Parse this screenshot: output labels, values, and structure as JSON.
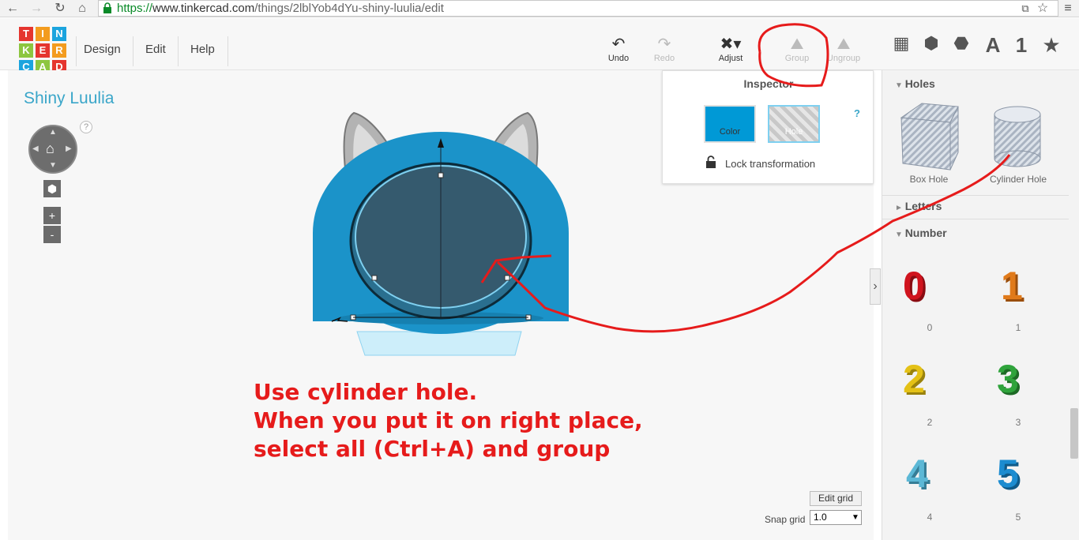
{
  "browser": {
    "url_scheme": "https://",
    "url_host": "www.tinkercad.com",
    "url_path": "/things/2lblYob4dYu-shiny-luulia/edit"
  },
  "logo": {
    "letters": [
      "T",
      "I",
      "N",
      "K",
      "E",
      "R",
      "C",
      "A",
      "D"
    ]
  },
  "menu": {
    "items": [
      "Design",
      "Edit",
      "Help"
    ]
  },
  "toolbar": {
    "undo": "Undo",
    "redo": "Redo",
    "adjust": "Adjust",
    "group": "Group",
    "ungroup": "Ungroup"
  },
  "right_tabs": {
    "letters_tab": "A",
    "numbers_tab": "1",
    "favorites_tab": "★"
  },
  "design": {
    "title": "Shiny Luulia"
  },
  "navigation": {
    "help": "?",
    "zoom_in": "+",
    "zoom_out": "-"
  },
  "inspector": {
    "title": "Inspector",
    "help": "?",
    "color_label": "Color",
    "hole_label": "Hole",
    "lock_label": "Lock transformation"
  },
  "panel": {
    "holes_section": "Holes",
    "letters_section": "Letters",
    "number_section": "Number",
    "box_hole": "Box Hole",
    "cylinder_hole": "Cylinder Hole",
    "numbers": [
      "0",
      "1",
      "2",
      "3",
      "4",
      "5"
    ]
  },
  "grid": {
    "edit_grid": "Edit grid",
    "snap_label": "Snap grid",
    "snap_value": "1.0"
  },
  "annotation": {
    "line1": "Use cylinder hole.",
    "line2": "When you put it on right place,",
    "line3": "select all (Ctrl+A) and group"
  },
  "colors": {
    "accent_blue": "#0099d6",
    "annotation_red": "#e61b1b",
    "logo_colors": [
      "#e5352f",
      "#f39c1f",
      "#1ba4de",
      "#8dc63f",
      "#e5352f",
      "#f39c1f",
      "#1ba4de",
      "#8dc63f",
      "#e5352f"
    ]
  }
}
